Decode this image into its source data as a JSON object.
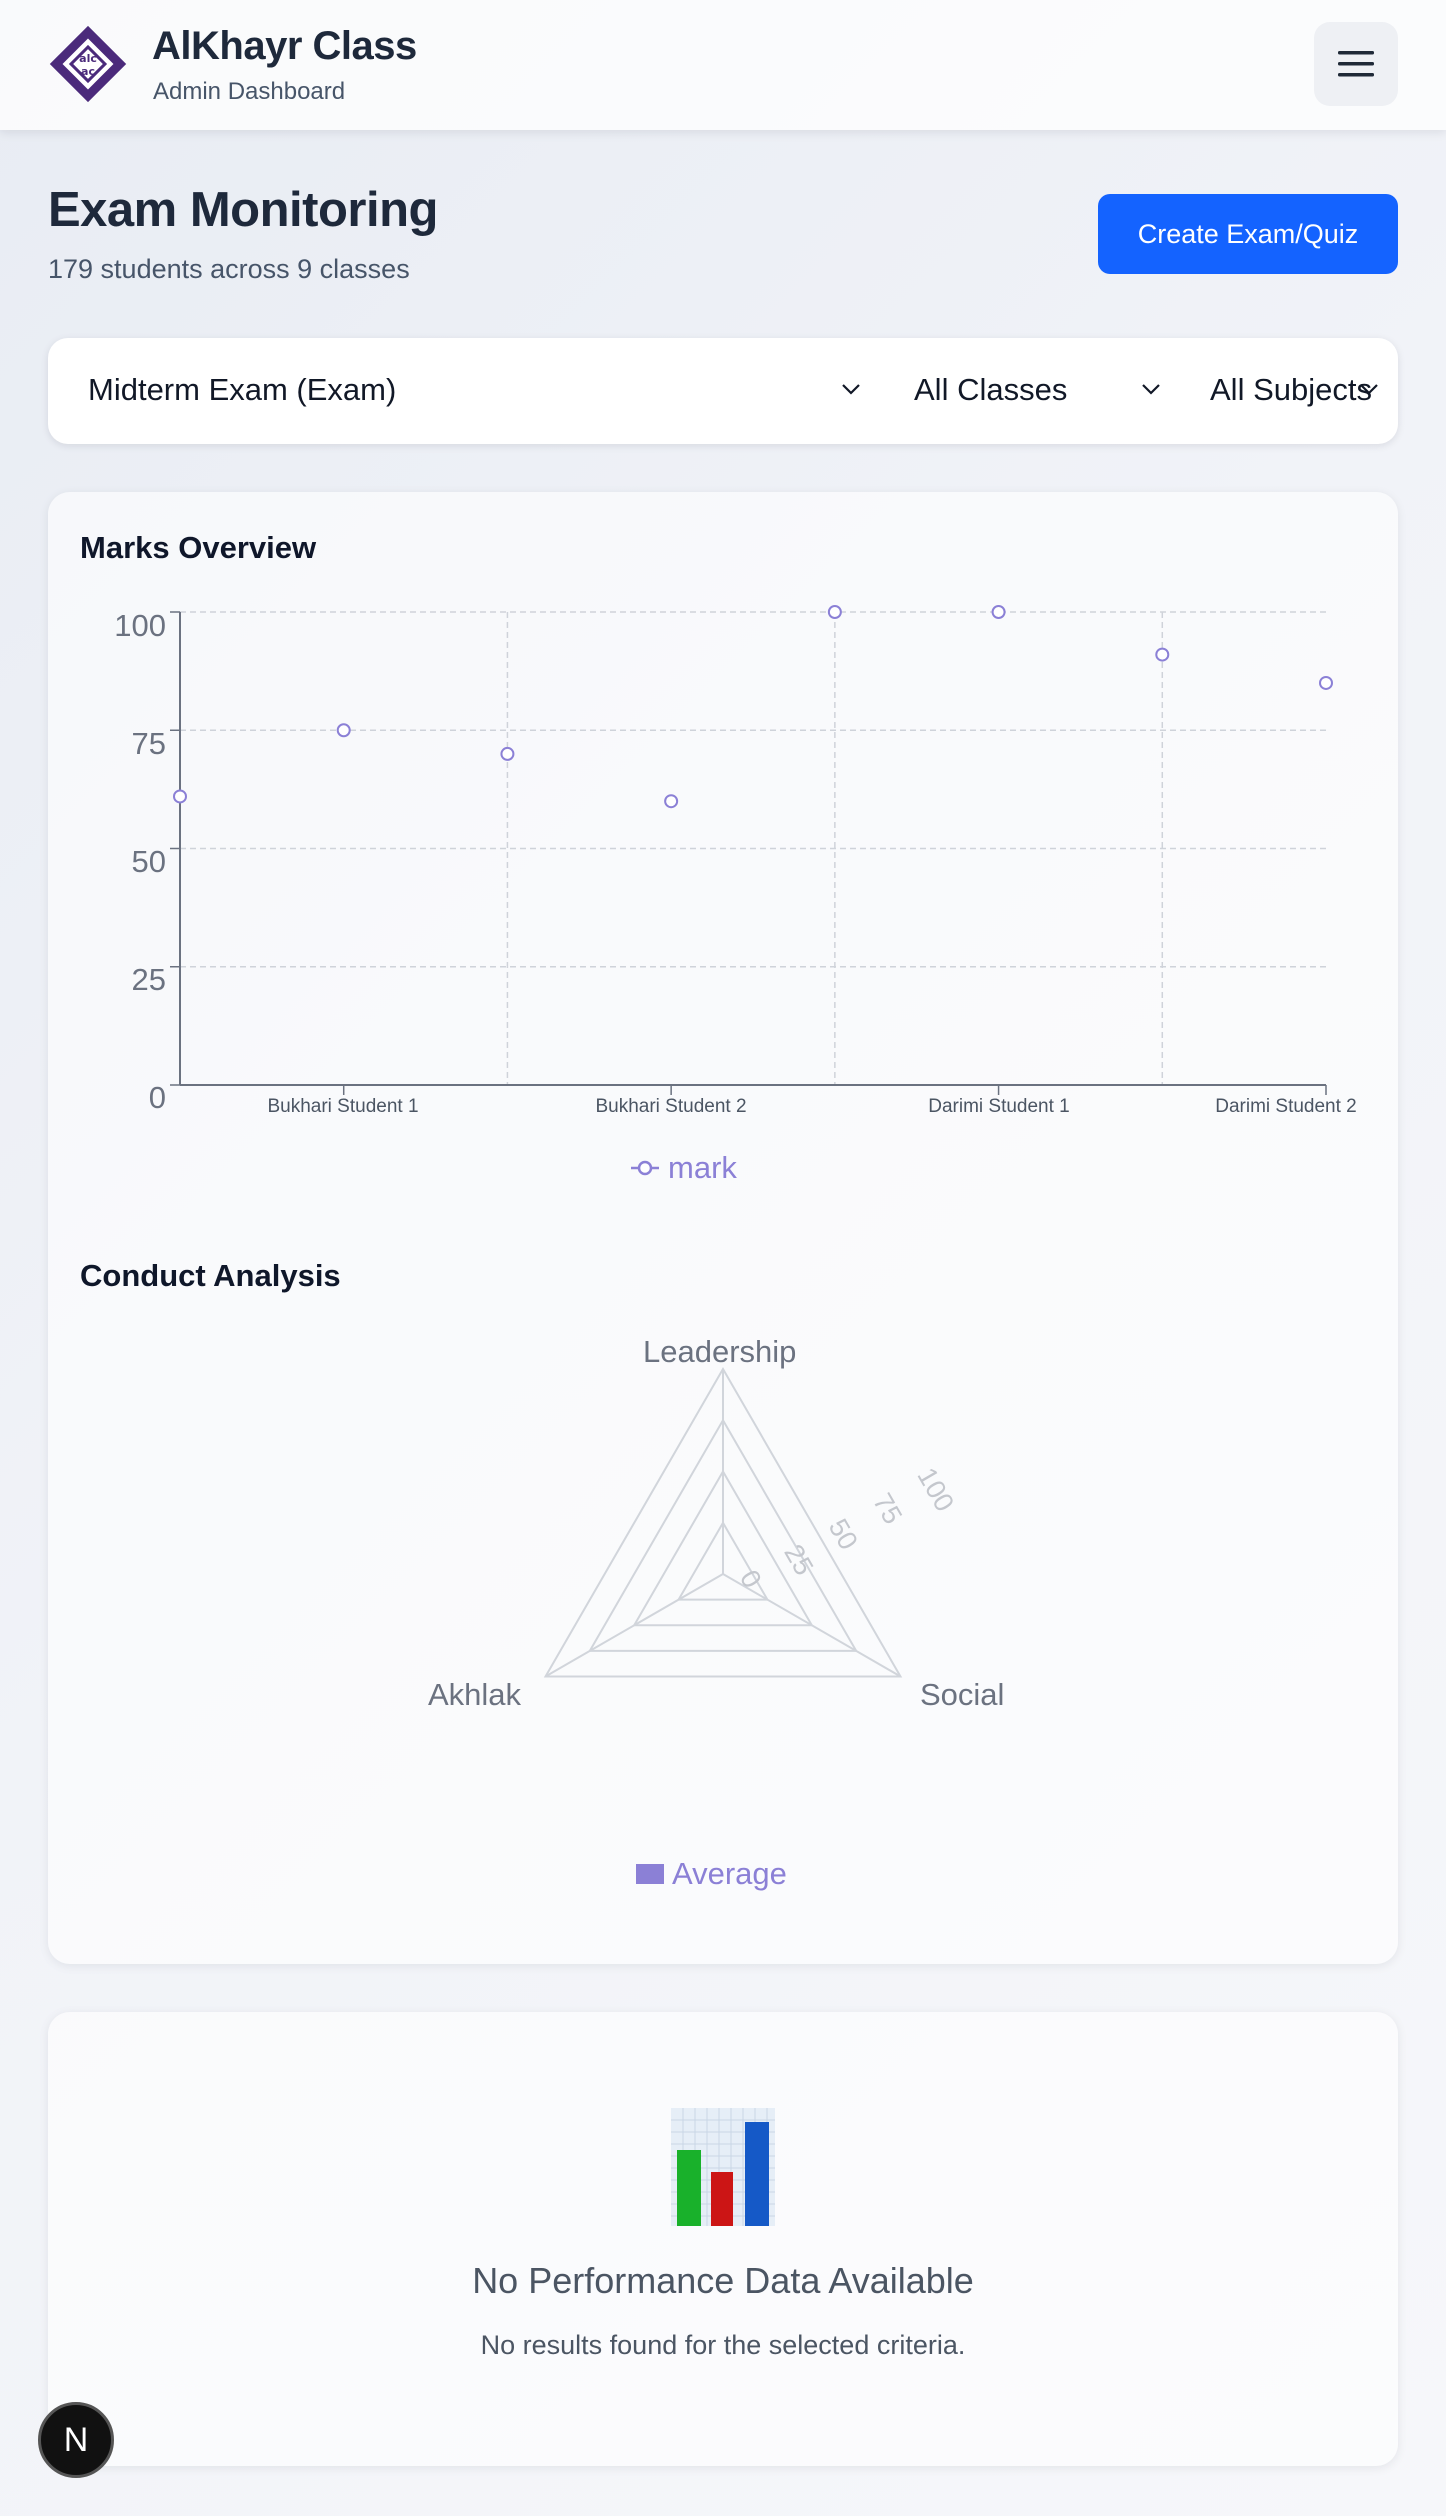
{
  "header": {
    "brand_title": "AlKhayr Class",
    "brand_subtitle": "Admin Dashboard",
    "logo_icon": "alkhayr-logo",
    "menu_icon": "hamburger-menu-icon"
  },
  "page": {
    "title": "Exam Monitoring",
    "subtitle": "179 students across 9 classes",
    "create_button": "Create Exam/Quiz"
  },
  "filters": {
    "exam": "Midterm Exam (Exam)",
    "class": "All Classes",
    "subject": "All Subjects"
  },
  "marks_overview": {
    "title": "Marks Overview",
    "y_ticks": [
      "100",
      "75",
      "50",
      "25",
      "0"
    ],
    "x_labels": [
      "Bukhari Student 1",
      "Bukhari Student 2",
      "Darimi Student 1",
      "Darimi Student 2"
    ],
    "legend": "mark"
  },
  "conduct_analysis": {
    "title": "Conduct Analysis",
    "axes": [
      "Leadership",
      "Social",
      "Akhlak"
    ],
    "ring_ticks": [
      "0",
      "25",
      "50",
      "75",
      "100"
    ],
    "legend": "Average"
  },
  "empty_state": {
    "icon": "bar-chart-icon",
    "title": "No Performance Data Available",
    "message": "No results found for the selected criteria."
  },
  "dev_badge": "N",
  "colors": {
    "primary": "#1463ff",
    "series": "#8b80d6",
    "logo": "#4b2a7b"
  },
  "chart_data": [
    {
      "type": "scatter",
      "title": "Marks Overview",
      "x": [
        "",
        "Bukhari Student 1",
        "",
        "Bukhari Student 2",
        "",
        "Darimi Student 1",
        "",
        "Darimi Student 2"
      ],
      "series": [
        {
          "name": "mark",
          "values": [
            61,
            75,
            70,
            60,
            100,
            100,
            91,
            85
          ]
        }
      ],
      "ylim": [
        0,
        100
      ],
      "y_ticks": [
        0,
        25,
        50,
        75,
        100
      ],
      "grid": true,
      "legend_placement": "bottom-center"
    },
    {
      "type": "radar",
      "title": "Conduct Analysis",
      "categories": [
        "Leadership",
        "Social",
        "Akhlak"
      ],
      "series": [
        {
          "name": "Average",
          "values": [
            0,
            0,
            0
          ]
        }
      ],
      "rlim": [
        0,
        100
      ],
      "r_ticks": [
        0,
        25,
        50,
        75,
        100
      ],
      "legend_placement": "bottom-center"
    }
  ]
}
